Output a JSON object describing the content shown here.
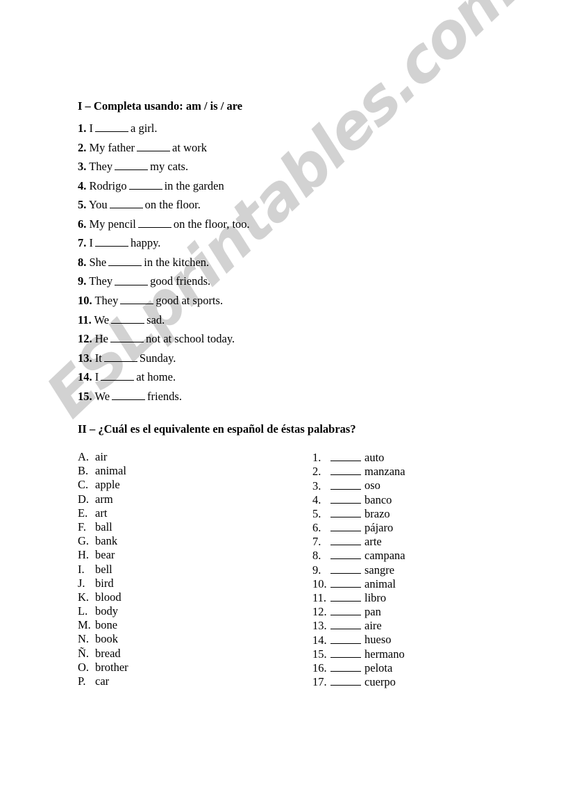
{
  "watermark": {
    "text": "ESLprintables.com",
    "color": "#d2d2d2"
  },
  "section_one": {
    "heading": "I – Completa usando:  am / is / are",
    "items": [
      {
        "num": "1.",
        "before": "I",
        "after": "a girl.",
        "blank_width": 48
      },
      {
        "num": "2.",
        "before": "My father",
        "after": "at work",
        "blank_width": 48
      },
      {
        "num": "3.",
        "before": "They",
        "after": "my cats.",
        "blank_width": 48
      },
      {
        "num": "4.",
        "before": "Rodrigo",
        "after": "in the garden",
        "blank_width": 48
      },
      {
        "num": "5.",
        "before": "You",
        "after": "on the floor.",
        "blank_width": 48
      },
      {
        "num": "6.",
        "before": "My pencil",
        "after": "on the floor, too.",
        "blank_width": 48
      },
      {
        "num": "7.",
        "before": "I",
        "after": "happy.",
        "blank_width": 48
      },
      {
        "num": "8.",
        "before": "She",
        "after": "in the kitchen.",
        "blank_width": 48
      },
      {
        "num": "9.",
        "before": "They",
        "after": "good friends.",
        "blank_width": 48
      },
      {
        "num": "10.",
        "before": "They",
        "after": "good at sports.",
        "blank_width": 48
      },
      {
        "num": "11.",
        "before": " We",
        "after": "sad.",
        "blank_width": 48
      },
      {
        "num": "12.",
        "before": "He",
        "after": "not at school today.",
        "blank_width": 48
      },
      {
        "num": "13.",
        "before": "It",
        "after": "Sunday.",
        "blank_width": 48
      },
      {
        "num": "14.",
        "before": "I",
        "after": "at home.",
        "blank_width": 48
      },
      {
        "num": "15.",
        "before": "We",
        "after": "friends.",
        "blank_width": 48
      }
    ]
  },
  "section_two": {
    "heading": "II –  ¿Cuál es el equivalente en español de éstas palabras?",
    "english_words": [
      {
        "label": "A.",
        "word": "air"
      },
      {
        "label": "B.",
        "word": "animal"
      },
      {
        "label": "C.",
        "word": "apple"
      },
      {
        "label": "D.",
        "word": "arm"
      },
      {
        "label": "E.",
        "word": "art"
      },
      {
        "label": "F.",
        "word": "ball"
      },
      {
        "label": "G.",
        "word": "bank"
      },
      {
        "label": "H.",
        "word": "bear"
      },
      {
        "label": "I.",
        "word": "bell"
      },
      {
        "label": "J.",
        "word": "bird"
      },
      {
        "label": "K.",
        "word": "blood"
      },
      {
        "label": "L.",
        "word": "body"
      },
      {
        "label": "M.",
        "word": "bone"
      },
      {
        "label": "N.",
        "word": "book"
      },
      {
        "label": "Ñ.",
        "word": "bread"
      },
      {
        "label": "O.",
        "word": "brother"
      },
      {
        "label": "P.",
        "word": "car"
      }
    ],
    "spanish_words": [
      {
        "label": "1.",
        "word": "auto"
      },
      {
        "label": "2.",
        "word": "manzana"
      },
      {
        "label": "3.",
        "word": "oso"
      },
      {
        "label": "4.",
        "word": "banco"
      },
      {
        "label": "5.",
        "word": "brazo"
      },
      {
        "label": "6.",
        "word": "pájaro"
      },
      {
        "label": "7.",
        "word": "arte"
      },
      {
        "label": "8.",
        "word": "campana"
      },
      {
        "label": "9.",
        "word": "sangre"
      },
      {
        "label": "10.",
        "word": "animal"
      },
      {
        "label": "11.",
        "word": "libro"
      },
      {
        "label": "12.",
        "word": "pan"
      },
      {
        "label": "13.",
        "word": "aire"
      },
      {
        "label": "14.",
        "word": "hueso"
      },
      {
        "label": "15.",
        "word": "hermano"
      },
      {
        "label": "16.",
        "word": "pelota"
      },
      {
        "label": "17.",
        "word": "cuerpo"
      }
    ]
  }
}
